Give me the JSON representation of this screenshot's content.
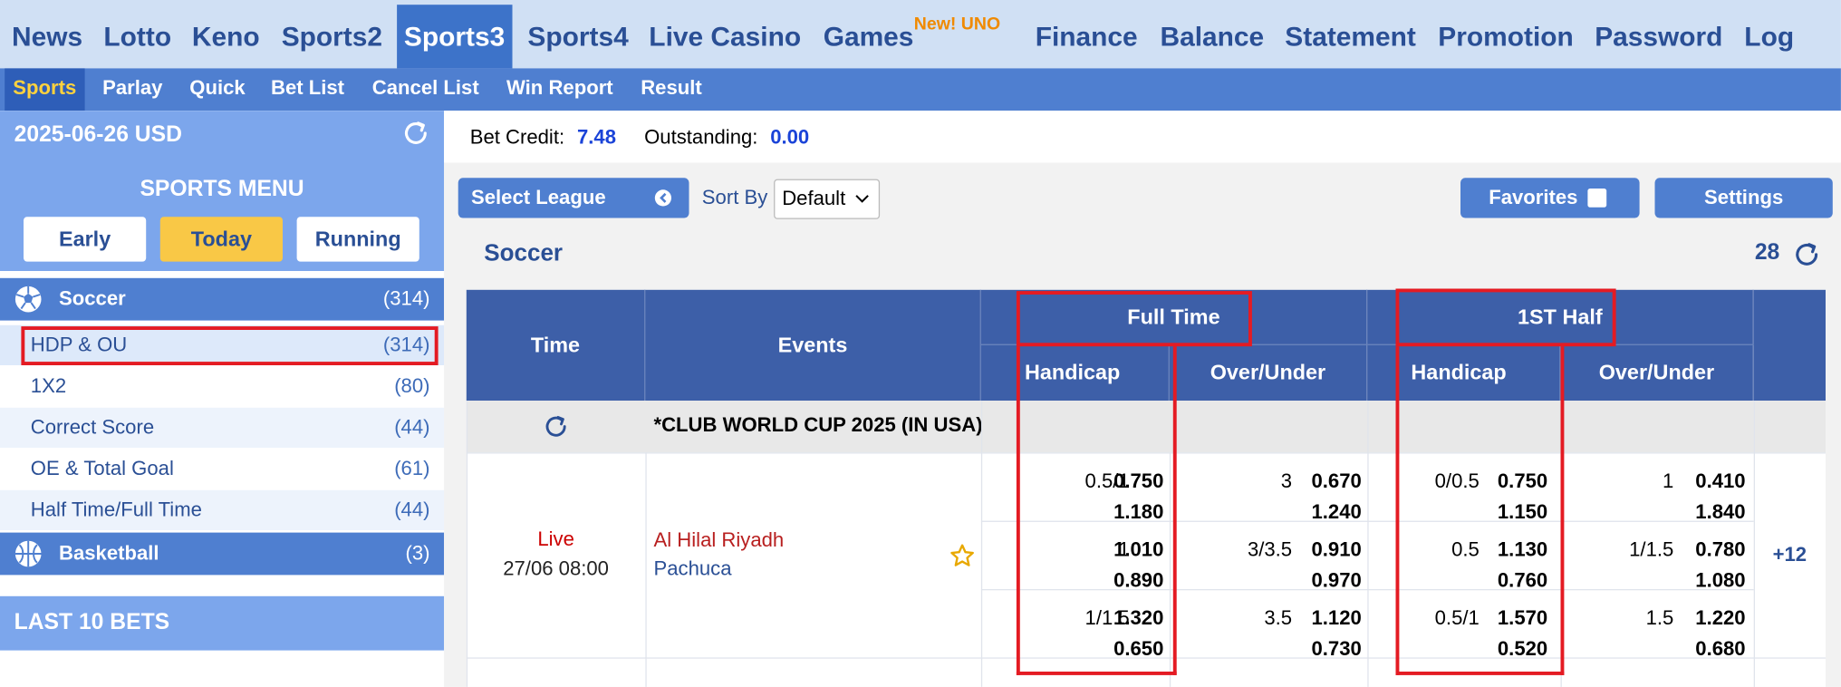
{
  "top_nav": {
    "items": [
      {
        "label": "News"
      },
      {
        "label": "Lotto"
      },
      {
        "label": "Keno"
      },
      {
        "label": "Sports2"
      },
      {
        "label": "Sports3"
      },
      {
        "label": "Sports4"
      },
      {
        "label": "Live Casino"
      },
      {
        "label": "Games"
      },
      {
        "label": "Finance"
      },
      {
        "label": "Balance"
      },
      {
        "label": "Statement"
      },
      {
        "label": "Promotion"
      },
      {
        "label": "Password"
      },
      {
        "label": "Log"
      }
    ],
    "active": "Sports3",
    "games_badge": "New! UNO"
  },
  "sub_nav": {
    "items": [
      {
        "label": "Sports"
      },
      {
        "label": "Parlay"
      },
      {
        "label": "Quick"
      },
      {
        "label": "Bet List"
      },
      {
        "label": "Cancel List"
      },
      {
        "label": "Win Report"
      },
      {
        "label": "Result"
      }
    ],
    "active": "Sports"
  },
  "sidebar": {
    "date_currency": "2025-06-26 USD",
    "menu_title": "SPORTS MENU",
    "period_buttons": [
      {
        "label": "Early"
      },
      {
        "label": "Today"
      },
      {
        "label": "Running"
      }
    ],
    "active_period": "Today",
    "soccer": {
      "label": "Soccer",
      "count": "(314)",
      "icon": "soccer-ball-icon"
    },
    "soccer_markets": [
      {
        "label": "HDP & OU",
        "count": "(314)"
      },
      {
        "label": "1X2",
        "count": "(80)"
      },
      {
        "label": "Correct Score",
        "count": "(44)"
      },
      {
        "label": "OE & Total Goal",
        "count": "(61)"
      },
      {
        "label": "Half Time/Full Time",
        "count": "(44)"
      }
    ],
    "basketball": {
      "label": "Basketball",
      "count": "(3)",
      "icon": "basketball-icon"
    },
    "last_bets": "LAST 10 BETS"
  },
  "account": {
    "bet_credit_label": "Bet Credit:",
    "bet_credit_value": "7.48",
    "outstanding_label": "Outstanding:",
    "outstanding_value": "0.00"
  },
  "toolbar": {
    "select_league": "Select League",
    "sort_by_label": "Sort By",
    "sort_value": "Default",
    "favorites": "Favorites",
    "settings": "Settings"
  },
  "section": {
    "title": "Soccer",
    "count": "28"
  },
  "table": {
    "headers": {
      "time": "Time",
      "events": "Events",
      "full_time": "Full Time",
      "first_half": "1ST Half",
      "handicap": "Handicap",
      "over_under": "Over/Under"
    },
    "league": "*CLUB WORLD CUP 2025 (IN USA)",
    "match": {
      "status": "Live",
      "datetime": "27/06 08:00",
      "home": "Al Hilal Riyadh",
      "away": "Pachuca",
      "more": "+12",
      "lines": [
        {
          "ft_hdp": {
            "line": "0.5/1",
            "home": "0.750",
            "away": "1.180"
          },
          "ft_ou": {
            "line": "3",
            "over": "0.670",
            "under": "1.240"
          },
          "h1_hdp": {
            "line": "0/0.5",
            "home": "0.750",
            "away": "1.150"
          },
          "h1_ou": {
            "line": "1",
            "over": "0.410",
            "under": "1.840"
          }
        },
        {
          "ft_hdp": {
            "line": "1",
            "home": "1.010",
            "away": "0.890"
          },
          "ft_ou": {
            "line": "3/3.5",
            "over": "0.910",
            "under": "0.970"
          },
          "h1_hdp": {
            "line": "0.5",
            "home": "1.130",
            "away": "0.760"
          },
          "h1_ou": {
            "line": "1/1.5",
            "over": "0.780",
            "under": "1.080"
          }
        },
        {
          "ft_hdp": {
            "line": "1/1.5",
            "home": "1.320",
            "away": "0.650"
          },
          "ft_ou": {
            "line": "3.5",
            "over": "1.120",
            "under": "0.730"
          },
          "h1_hdp": {
            "line": "0.5/1",
            "home": "1.570",
            "away": "0.520"
          },
          "h1_ou": {
            "line": "1.5",
            "over": "1.220",
            "under": "0.680"
          }
        }
      ]
    }
  },
  "colors": {
    "nav_bg": "#d0e0f4",
    "nav_active": "#3d73c9",
    "subnav_bg": "#4f7fd0",
    "table_header": "#3d5fa8",
    "highlight_box": "#e41b23",
    "live_red": "#cc0000",
    "badge_orange": "#f08a00"
  }
}
